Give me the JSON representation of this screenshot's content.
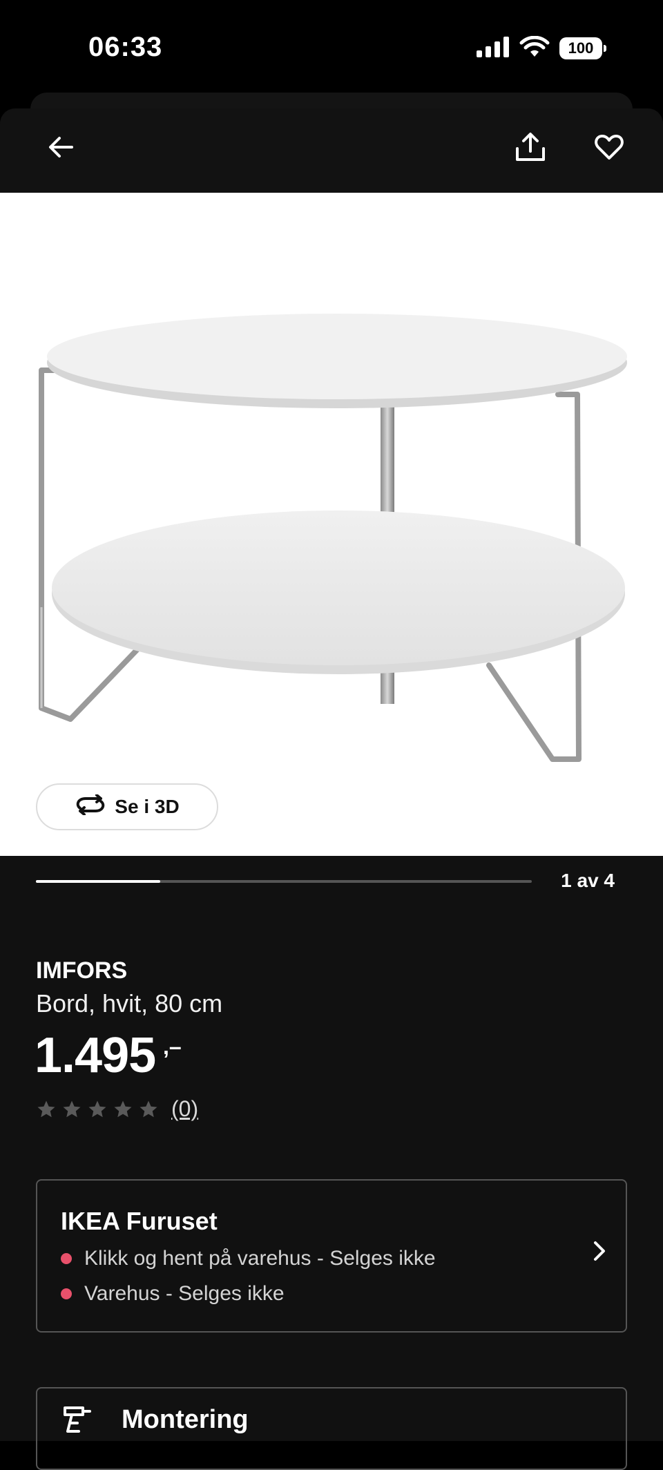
{
  "status_bar": {
    "time": "06:33",
    "battery": "100",
    "icons": [
      "signal-icon",
      "wifi-icon",
      "battery-icon"
    ]
  },
  "nav": {
    "icons": [
      "back-arrow-icon",
      "share-icon",
      "heart-icon"
    ]
  },
  "gallery": {
    "view_3d_label": "Se i 3D",
    "position_text": "1 av 4",
    "current_index": 1,
    "total_images": 4
  },
  "product": {
    "name": "IMFORS",
    "description": "Bord, hvit, 80 cm",
    "price_main": "1.495",
    "price_decimal": ",–",
    "rating_stars": 0,
    "rating_max": 5,
    "review_count": "(0)"
  },
  "store": {
    "title": "IKEA Furuset",
    "availability": [
      {
        "text": "Klikk og hent på varehus - Selges ikke",
        "status_color": "#e8516b"
      },
      {
        "text": "Varehus - Selges ikke",
        "status_color": "#e8516b"
      }
    ]
  },
  "assembly": {
    "title": "Montering"
  },
  "colors": {
    "background": "#111111",
    "accent_unavailable": "#e8516b"
  }
}
